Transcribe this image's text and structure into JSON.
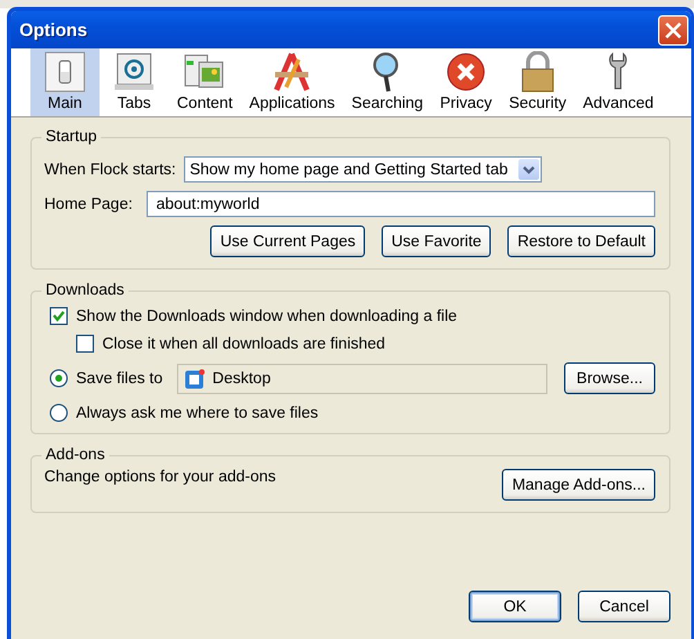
{
  "window": {
    "title": "Options"
  },
  "toolbar": [
    {
      "label": "Main",
      "selected": true
    },
    {
      "label": "Tabs",
      "selected": false
    },
    {
      "label": "Content",
      "selected": false
    },
    {
      "label": "Applications",
      "selected": false
    },
    {
      "label": "Searching",
      "selected": false
    },
    {
      "label": "Privacy",
      "selected": false
    },
    {
      "label": "Security",
      "selected": false
    },
    {
      "label": "Advanced",
      "selected": false
    }
  ],
  "startup": {
    "title": "Startup",
    "start_label": "When Flock starts:",
    "start_value": "Show my home page and Getting Started tab",
    "home_label": "Home Page:",
    "home_value": "about:myworld",
    "buttons": [
      "Use Current Pages",
      "Use Favorite",
      "Restore to Default"
    ]
  },
  "downloads": {
    "title": "Downloads",
    "show_window": {
      "label": "Show the Downloads window when downloading a file",
      "checked": true,
      "children": [
        {
          "label": "Close it when all downloads are finished",
          "checked": false
        }
      ]
    },
    "save_options": [
      {
        "kind": "folder",
        "label": "Save files to",
        "selected": true,
        "folder": "Desktop",
        "button": "Browse..."
      },
      {
        "kind": "plain",
        "label": "Always ask me where to save files",
        "selected": false
      }
    ]
  },
  "addons": {
    "title": "Add-ons",
    "text": "Change options for your add-ons",
    "button": "Manage Add-ons..."
  },
  "buttons": [
    {
      "label": "OK",
      "default": true
    },
    {
      "label": "Cancel",
      "default": false
    }
  ]
}
